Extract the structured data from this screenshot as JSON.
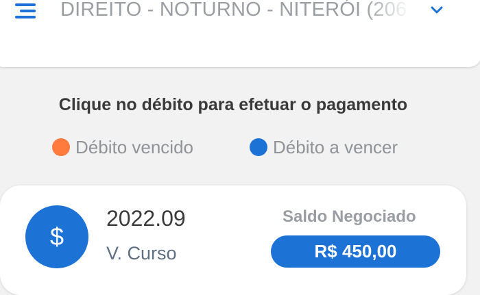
{
  "colors": {
    "accent": "#1d72d6",
    "overdue": "#ff7a3d",
    "upcoming": "#1d72d6",
    "text_dark": "#3a3a3a",
    "text_muted": "#9a9ea3"
  },
  "header": {
    "menu_icon": "hamburger-menu-icon",
    "course_selector": {
      "selected": "DIREITO - NOTURNO - NITERÓI (206/",
      "icon": "chevron-down-icon"
    }
  },
  "instruction": "Clique no débito para efetuar o pagamento",
  "legend": {
    "overdue_label": "Débito vencido",
    "upcoming_label": "Débito a vencer"
  },
  "debits": [
    {
      "icon": "dollar-sign-icon",
      "icon_symbol": "$",
      "period": "2022.09",
      "description": "V. Curso",
      "balance_label": "Saldo Negociado",
      "amount": "R$ 450,00",
      "status": "upcoming"
    }
  ]
}
